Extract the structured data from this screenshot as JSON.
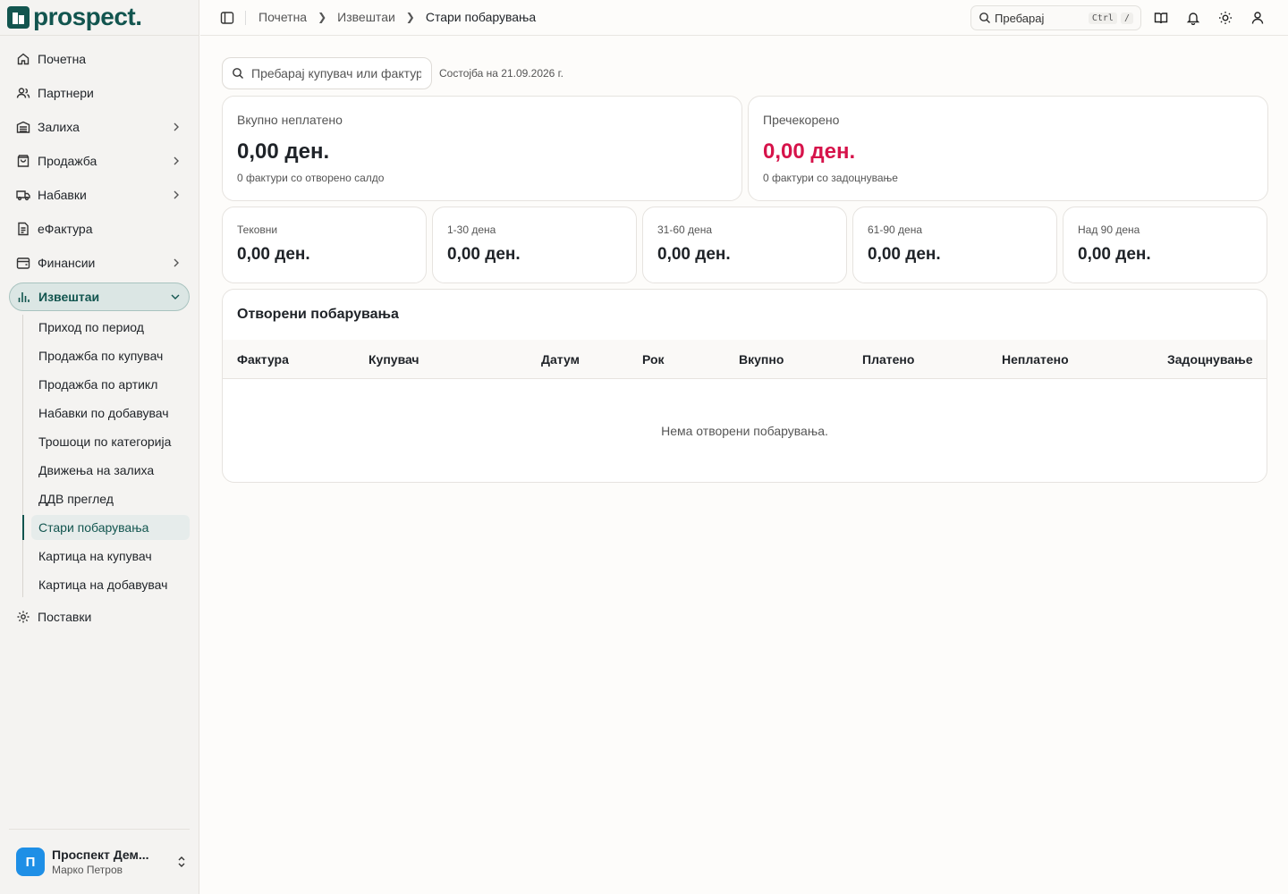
{
  "brand": {
    "logo_text": "prospect."
  },
  "sidebar": {
    "items": [
      {
        "label": "Почетна"
      },
      {
        "label": "Партнери"
      },
      {
        "label": "Залиха"
      },
      {
        "label": "Продажба"
      },
      {
        "label": "Набавки"
      },
      {
        "label": "еФактура"
      },
      {
        "label": "Финансии"
      },
      {
        "label": "Извештаи"
      },
      {
        "label": "Поставки"
      }
    ],
    "reports_sub": [
      "Приход по период",
      "Продажба по купувач",
      "Продажба по артикл",
      "Набавки по добавувач",
      "Трошоци по категорија",
      "Движења на залиха",
      "ДДВ преглед",
      "Стари побарувања",
      "Картица на купувач",
      "Картица на добавувач"
    ],
    "account": {
      "avatar_letter": "П",
      "company": "Проспект Дем...",
      "user": "Марко Петров"
    }
  },
  "topbar": {
    "breadcrumb": [
      "Почетна",
      "Извештаи",
      "Стари побарувања"
    ],
    "search_placeholder": "Пребарај",
    "kbd_ctrl": "Ctrl",
    "kbd_slash": "/"
  },
  "filter": {
    "placeholder": "Пребарај купувач или фактура",
    "as_of": "Состојба на 21.09.2026 г."
  },
  "summary": {
    "total": {
      "title": "Вкупно неплатено",
      "value": "0,00 ден.",
      "sub": "0 фактури со отворено салдо"
    },
    "overdue": {
      "title": "Пречекорено",
      "value": "0,00 ден.",
      "sub": "0 фактури со задоцнување"
    }
  },
  "aging": [
    {
      "title": "Тековни",
      "value": "0,00 ден."
    },
    {
      "title": "1-30 дена",
      "value": "0,00 ден."
    },
    {
      "title": "31-60 дена",
      "value": "0,00 ден."
    },
    {
      "title": "61-90 дена",
      "value": "0,00 ден."
    },
    {
      "title": "Над 90 дена",
      "value": "0,00 ден."
    }
  ],
  "table": {
    "title": "Отворени побарувања",
    "columns": [
      "Фактура",
      "Купувач",
      "Датум",
      "Рок",
      "Вкупно",
      "Платено",
      "Неплатено",
      "Задоцнување"
    ],
    "empty_text": "Нема отворени побарувања."
  },
  "colors": {
    "brand": "#12554f",
    "overdue": "#d6134a",
    "avatar": "#1e8fe6"
  }
}
